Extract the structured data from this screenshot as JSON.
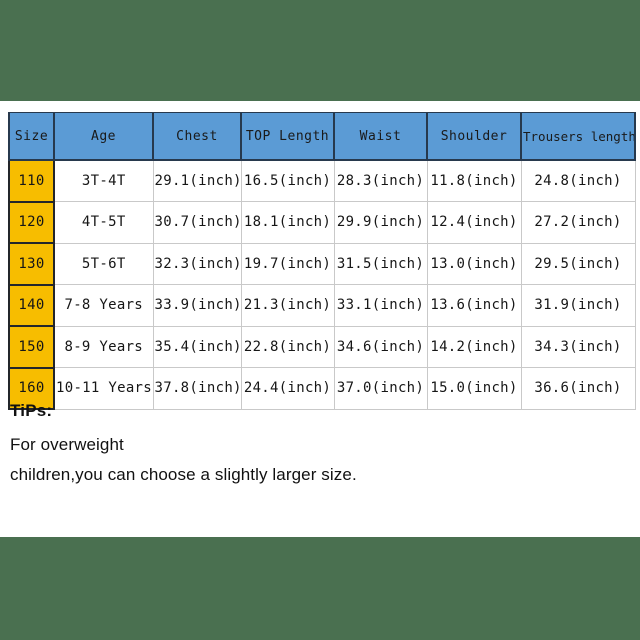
{
  "bands": {
    "color": "#4a7050",
    "top_label": "top-background-band",
    "bottom_label": "bottom-background-band"
  },
  "theme": {
    "header_blue": "#5b9bd5",
    "size_yellow": "#f7bd00",
    "cell_white": "#ffffff",
    "text_dark": "#161616"
  },
  "table": {
    "headers": [
      "Size",
      "Age",
      "Chest",
      "TOP Length",
      "Waist",
      "Shoulder",
      "Trousers length"
    ],
    "rows": [
      {
        "size": "110",
        "age": "3T-4T",
        "chest": "29.1(inch)",
        "top_length": "16.5(inch)",
        "waist": "28.3(inch)",
        "shoulder": "11.8(inch)",
        "trousers_length": "24.8(inch)"
      },
      {
        "size": "120",
        "age": "4T-5T",
        "chest": "30.7(inch)",
        "top_length": "18.1(inch)",
        "waist": "29.9(inch)",
        "shoulder": "12.4(inch)",
        "trousers_length": "27.2(inch)"
      },
      {
        "size": "130",
        "age": "5T-6T",
        "chest": "32.3(inch)",
        "top_length": "19.7(inch)",
        "waist": "31.5(inch)",
        "shoulder": "13.0(inch)",
        "trousers_length": "29.5(inch)"
      },
      {
        "size": "140",
        "age": "7-8 Years",
        "chest": "33.9(inch)",
        "top_length": "21.3(inch)",
        "waist": "33.1(inch)",
        "shoulder": "13.6(inch)",
        "trousers_length": "31.9(inch)"
      },
      {
        "size": "150",
        "age": "8-9 Years",
        "chest": "35.4(inch)",
        "top_length": "22.8(inch)",
        "waist": "34.6(inch)",
        "shoulder": "14.2(inch)",
        "trousers_length": "34.3(inch)"
      },
      {
        "size": "160",
        "age": "10-11 Years",
        "chest": "37.8(inch)",
        "top_length": "24.4(inch)",
        "waist": "37.0(inch)",
        "shoulder": "15.0(inch)",
        "trousers_length": "36.6(inch)"
      }
    ]
  },
  "tips": {
    "title": "TiPs:",
    "line1": "For overweight",
    "line2": "children,you can choose a slightly larger size."
  }
}
